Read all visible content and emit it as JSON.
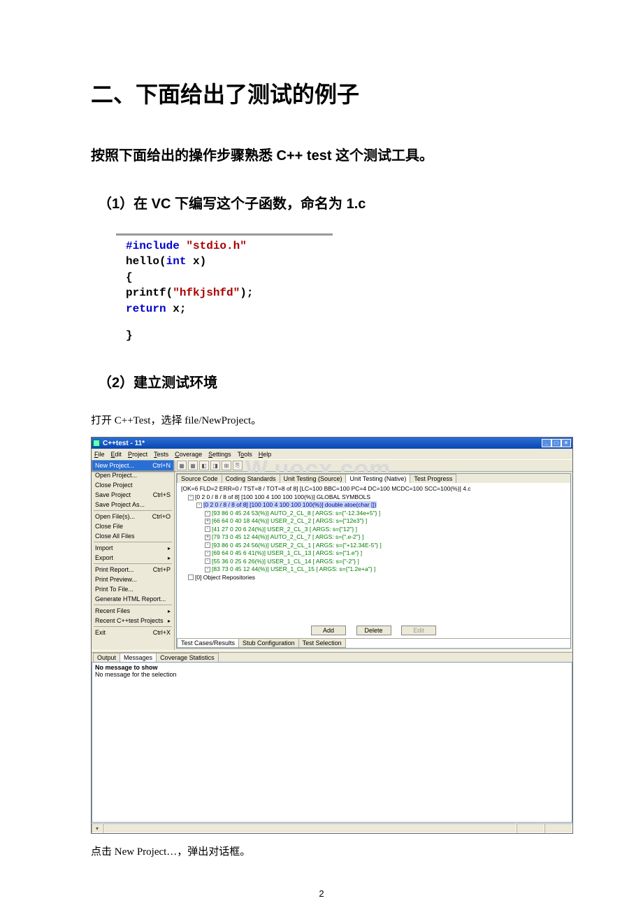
{
  "doc": {
    "h1": "二、下面给出了测试的例子",
    "h2": "按照下面给出的操作步骤熟悉 C++ test 这个测试工具。",
    "h3_1": "（1）在 VC 下编写这个子函数，命名为 1.c",
    "code": {
      "l1a": "#include",
      "l1b": " \"stdio.h\"",
      "l2a": "hello(",
      "l2b": "int",
      "l2c": " x)",
      "l3": "{",
      "l4a": "      printf(",
      "l4b": "\"hfkjshfd\"",
      "l4c": ");",
      "l5a": "      ",
      "l5b": "return",
      "l5c": " x;",
      "l6": "}"
    },
    "h3_2": "（2）建立测试环境",
    "para1": "打开 C++Test，选择 file/NewProject。",
    "para2": "点击 New Project…，弹出对话框。",
    "pagenum": "2"
  },
  "ui": {
    "title": "C++test - 11*",
    "watermark": "W.uocx.com",
    "menubar": [
      "File",
      "Edit",
      "Project",
      "Tests",
      "Coverage",
      "Settings",
      "Tools",
      "Help"
    ],
    "menubar_u": [
      "F",
      "E",
      "P",
      "T",
      "C",
      "S",
      "o",
      "H"
    ],
    "dropdown": [
      {
        "label": "New Project...",
        "sc": "Ctrl+N",
        "sel": true
      },
      {
        "label": "Open Project..."
      },
      {
        "label": "Close Project"
      },
      {
        "label": "Save Project",
        "sc": "Ctrl+S"
      },
      {
        "label": "Save Project As..."
      },
      {
        "sep": true
      },
      {
        "label": "Open File(s)...",
        "sc": "Ctrl+O"
      },
      {
        "label": "Close File"
      },
      {
        "label": "Close All Files"
      },
      {
        "sep": true
      },
      {
        "label": "Import",
        "sub": true
      },
      {
        "label": "Export",
        "sub": true
      },
      {
        "sep": true
      },
      {
        "label": "Print Report...",
        "sc": "Ctrl+P"
      },
      {
        "label": "Print Preview..."
      },
      {
        "label": "Print To File..."
      },
      {
        "label": "Generate HTML Report..."
      },
      {
        "sep": true
      },
      {
        "label": "Recent Files",
        "sub": true
      },
      {
        "label": "Recent C++test Projects",
        "sub": true
      },
      {
        "sep": true
      },
      {
        "label": "Exit",
        "sc": "Ctrl+X"
      }
    ],
    "tabs_top": [
      "Source Code",
      "Coding Standards",
      "Unit Testing (Source)",
      "Unit Testing (Native)",
      "Test Progress"
    ],
    "tabs_top_active": 3,
    "tree": [
      {
        "cls": "t-black indent0",
        "txt": "[OK=6 FLD=2 ERR=0 / TST=8 / TOT=8 of 8]  [LC=100 BBC=100 PC=4 DC=100 MCDC=100 SCC=100(%)] 4.c"
      },
      {
        "cls": "t-black indent1",
        "txt": "[0 2 0 / 8 / 8 of 8]  [100 100 4 100 100 100(%)] GLOBAL SYMBOLS",
        "box": "-"
      },
      {
        "cls": "t-blue indent2",
        "txt": "[0 2 0 / 8 / 8 of 8]  [100 100 4 100 100 100(%)] double atoe(char [])",
        "box": "-",
        "bg": true
      },
      {
        "cls": "t-green indent3",
        "txt": "[93 86 0 45 24 53(%)] AUTO_2_CL_8    [ ARGS: s={\"-12.34e+5\"} ]",
        "box": "-"
      },
      {
        "cls": "t-green indent3",
        "txt": "[66 64 0 40 18 44(%)] USER_2_CL_2    [ ARGS: s={\"12e3\"} ]",
        "box": "+"
      },
      {
        "cls": "t-green indent3",
        "txt": "[41 27 0 20 6 24(%)] USER_2_CL_3    [ ARGS: s={\"12\"} ]",
        "box": "-"
      },
      {
        "cls": "t-green indent3",
        "txt": "[79 73 0 45 12 44(%)] AUTO_2_CL_7    [ ARGS: s={\".e-2\"} ]",
        "box": "+"
      },
      {
        "cls": "t-green indent3",
        "txt": "[93 86 0 45 24 56(%)] USER_2_CL_1    [ ARGS: s={\"+12.34E-5\"} ]",
        "box": "-"
      },
      {
        "cls": "t-green indent3",
        "txt": "[69 64 0 45 6 41(%)] USER_1_CL_13   [ ARGS: s={\"1.e\"} ]",
        "box": "-"
      },
      {
        "cls": "t-green indent3",
        "txt": "[55 36 0 25 6 26(%)] USER_1_CL_14   [ ARGS: s={\"-2\"} ]",
        "box": "-"
      },
      {
        "cls": "t-green indent3",
        "txt": "[83 73 0 45 12 44(%)] USER_1_CL_15   [ ARGS: s={\"1.2e+a\"} ]",
        "box": "-"
      },
      {
        "cls": "t-black indent1",
        "txt": "[0] Object Repositories",
        "box": " "
      }
    ],
    "btns": {
      "add": "Add",
      "delete": "Delete",
      "edit": "Edit"
    },
    "tabs_bottom": [
      "Test Cases/Results",
      "Stub Configuration",
      "Test Selection"
    ],
    "tabs_bottom_active": 0,
    "lower_tabs": [
      "Output",
      "Messages",
      "Coverage Statistics"
    ],
    "lower_tabs_active": 1,
    "lower_msg1": "No message to show",
    "lower_msg2": "No message for the selection"
  }
}
